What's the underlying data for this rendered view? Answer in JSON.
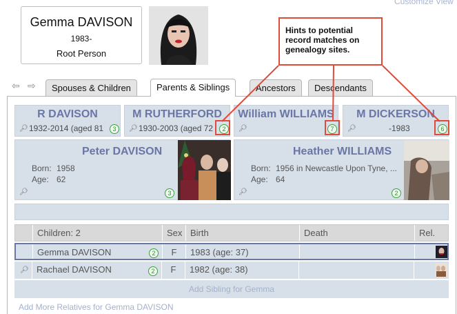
{
  "top": {
    "customize_link": "Customize View"
  },
  "root": {
    "name": "Gemma DAVISON",
    "years": "1983-",
    "label": "Root Person"
  },
  "tabs": [
    "Spouses & Children",
    "Parents & Siblings",
    "Ancestors",
    "Descendants"
  ],
  "active_tab": "Parents & Siblings",
  "grandparents": [
    {
      "name": "R DAVISON",
      "dates": "1932-2014 (aged 81",
      "hints": "3"
    },
    {
      "name": "M RUTHERFORD",
      "dates": "1930-2003 (aged 72",
      "hints": "2"
    },
    {
      "name": "William WILLIAMS",
      "dates": "",
      "hints": "7"
    },
    {
      "name": "M DICKERSON",
      "dates": "-1983",
      "hints": "6"
    }
  ],
  "parents": [
    {
      "name": "Peter DAVISON",
      "born_label": "Born:",
      "born": "1958",
      "age_label": "Age:",
      "age": "62",
      "hints": "3"
    },
    {
      "name": "Heather WILLIAMS",
      "born_label": "Born:",
      "born": "1956 in Newcastle Upon Tyne, ...",
      "age_label": "Age:",
      "age": "64",
      "hints": "2"
    }
  ],
  "children_table": {
    "headers": {
      "children": "Children: 2",
      "sex": "Sex",
      "birth": "Birth",
      "death": "Death",
      "rel": "Rel."
    },
    "rows": [
      {
        "name": "Gemma DAVISON",
        "hints": "2",
        "sex": "F",
        "birth": "1983 (age: 37)",
        "death": ""
      },
      {
        "name": "Rachael DAVISON",
        "hints": "2",
        "sex": "F",
        "birth": "1982 (age: 38)",
        "death": ""
      }
    ],
    "add_sibling": "Add Sibling for Gemma"
  },
  "add_more": "Add More Relatives for Gemma DAVISON",
  "callout": {
    "text": "Hints to potential record matches on genealogy sites."
  },
  "colors": {
    "card_bg": "#d7dfe9",
    "name_blue": "#6a76a6",
    "callout_red": "#e04a3a",
    "hint_green": "#3aa33a"
  }
}
